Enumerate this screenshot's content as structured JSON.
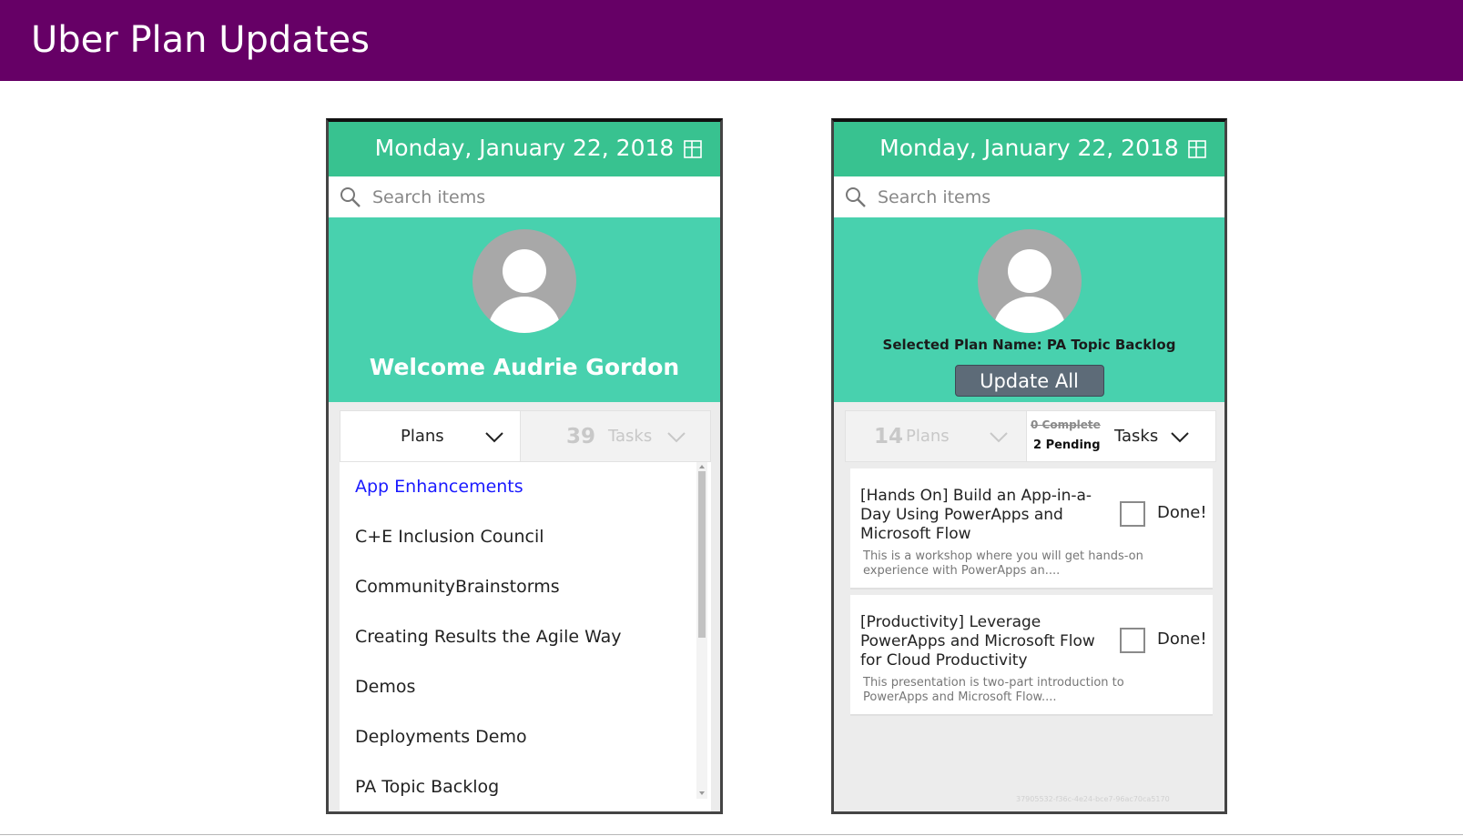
{
  "slide": {
    "title": "Uber Plan Updates"
  },
  "colors": {
    "banner": "#660066",
    "date_bar": "#38c290",
    "hero": "#48d1ae",
    "link": "#1a1aff",
    "update_button": "#5d6b78"
  },
  "left_phone": {
    "date": "Monday, January 22, 2018",
    "layout_icon": "layout-icon",
    "search": {
      "icon": "search-icon",
      "placeholder": "Search items"
    },
    "welcome": "Welcome Audrie Gordon",
    "tabs": {
      "plans_label": "Plans",
      "tasks_count": "39",
      "tasks_label": "Tasks"
    },
    "plans": [
      {
        "label": "App Enhancements",
        "active": true
      },
      {
        "label": "C+E Inclusion Council",
        "active": false
      },
      {
        "label": "CommunityBrainstorms",
        "active": false
      },
      {
        "label": "Creating Results the Agile Way",
        "active": false
      },
      {
        "label": "Demos",
        "active": false
      },
      {
        "label": "Deployments Demo",
        "active": false
      },
      {
        "label": "PA Topic Backlog",
        "active": false
      }
    ]
  },
  "right_phone": {
    "date": "Monday, January 22, 2018",
    "layout_icon": "layout-icon",
    "search": {
      "icon": "search-icon",
      "placeholder": "Search items"
    },
    "selected_plan": "Selected Plan Name: PA Topic Backlog",
    "update_all": "Update All",
    "tabs": {
      "plans_count": "14",
      "plans_label": "Plans",
      "complete": "0 Complete",
      "pending": "2 Pending",
      "tasks_label": "Tasks"
    },
    "tasks": [
      {
        "title": "[Hands On] Build an App-in-a-Day Using PowerApps and Microsoft Flow",
        "description": "This is a workshop where you will get hands-on experience with PowerApps an....",
        "done_label": "Done!"
      },
      {
        "title": "[Productivity] Leverage PowerApps and Microsoft Flow for Cloud Productivity",
        "description": "This presentation is two-part introduction to PowerApps and Microsoft Flow....",
        "done_label": "Done!"
      }
    ],
    "footer_id": "37905532-f36c-4e24-bce7-96ac70ca5170"
  }
}
